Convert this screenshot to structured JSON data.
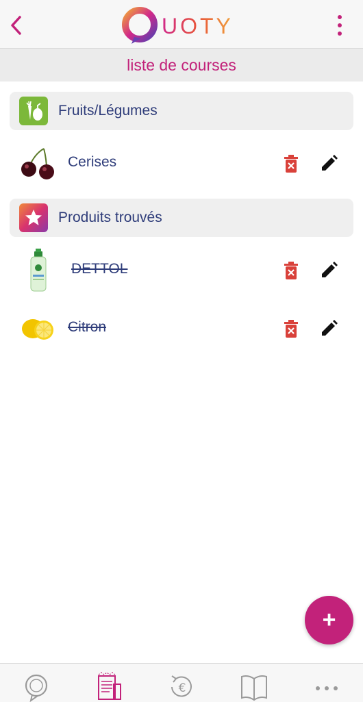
{
  "header": {
    "logo_text": "UOTY",
    "subtitle": "liste de courses"
  },
  "categories": [
    {
      "label": "Fruits/Légumes",
      "icon": "vegetables-icon",
      "color": "#7cb83a"
    },
    {
      "label": "Produits trouvés",
      "icon": "star-icon",
      "color": "#d8336e"
    }
  ],
  "items": [
    {
      "name": "Cerises",
      "image": "cherries-image",
      "checked": false
    },
    {
      "name": "DETTOL",
      "image": "dettol-bottle-image",
      "checked": true
    },
    {
      "name": "Citron",
      "image": "lemon-image",
      "checked": true
    }
  ],
  "fab": {
    "label": "+"
  },
  "tabbar": {
    "tabs": [
      "chat-icon",
      "shopping-list-icon",
      "euro-icon",
      "book-icon",
      "more-icon"
    ],
    "active": 1
  },
  "colors": {
    "accent": "#c2227a",
    "text": "#2f3d7a",
    "delete": "#d9413a"
  }
}
